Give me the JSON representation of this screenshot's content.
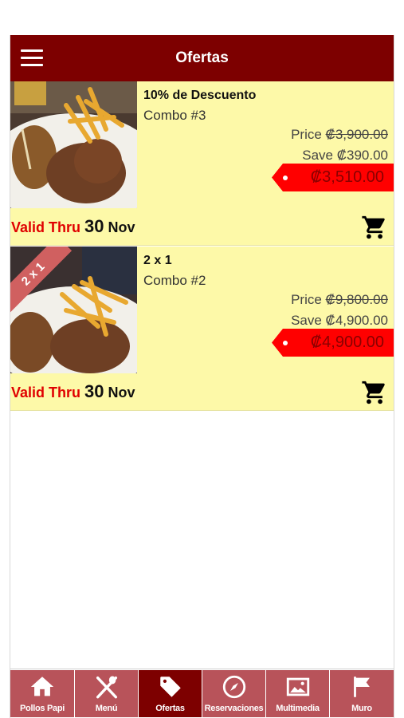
{
  "header": {
    "title": "Ofertas",
    "menu_icon": "hamburger-menu-icon"
  },
  "offers": [
    {
      "title": "10% de Descuento",
      "combo": "Combo #3",
      "price_label": "Price",
      "price_original": "₡3,900.00",
      "save_label": "Save",
      "save_amount": "₡390.00",
      "price_final": "₡3,510.00",
      "valid_label": "Valid Thru",
      "valid_day": "30",
      "valid_month": "Nov",
      "ribbon": ""
    },
    {
      "title": "2 x 1",
      "combo": "Combo #2",
      "price_label": "Price",
      "price_original": "₡9,800.00",
      "save_label": "Save",
      "save_amount": "₡4,900.00",
      "price_final": "₡4,900.00",
      "valid_label": "Valid Thru",
      "valid_day": "30",
      "valid_month": "Nov",
      "ribbon": "2 x 1"
    }
  ],
  "tabs": [
    {
      "label": "Pollos Papi",
      "icon": "home-icon"
    },
    {
      "label": "Menú",
      "icon": "utensils-icon"
    },
    {
      "label": "Ofertas",
      "icon": "tag-icon",
      "active": true
    },
    {
      "label": "Reservaciones",
      "icon": "compass-icon"
    },
    {
      "label": "Multimedia",
      "icon": "gallery-icon"
    },
    {
      "label": "Muro",
      "icon": "flag-icon"
    }
  ],
  "colors": {
    "header": "#7d0000",
    "offer_bg": "#fdf9a8",
    "price_tag": "#ff0000",
    "valid_label": "#e00000",
    "tab": "#b8535a",
    "tab_active": "#7d0000"
  }
}
